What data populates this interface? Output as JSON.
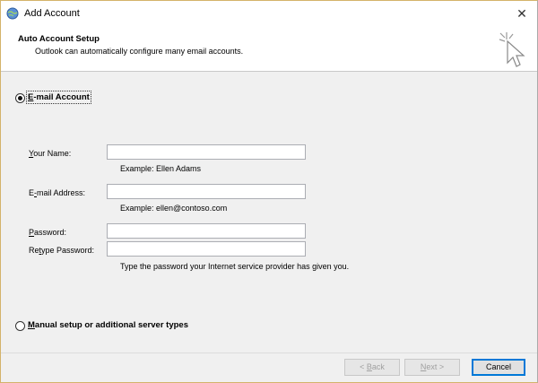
{
  "window": {
    "title": "Add Account",
    "close_glyph": "✕"
  },
  "header": {
    "title": "Auto Account Setup",
    "subtitle": "Outlook can automatically configure many email accounts."
  },
  "options": {
    "email_account": {
      "label_pre": "",
      "label_accel": "E",
      "label_post": "-mail Account",
      "selected": true
    },
    "manual_setup": {
      "label_accel": "M",
      "label_post": "anual setup or additional server types",
      "selected": false
    }
  },
  "form": {
    "name": {
      "label_accel": "Y",
      "label_post": "our Name:",
      "value": "",
      "hint": "Example: Ellen Adams"
    },
    "email": {
      "label_pre": "E",
      "label_accel": "-",
      "label_post": "mail Address:",
      "value": "",
      "hint": "Example: ellen@contoso.com"
    },
    "password": {
      "label_accel": "P",
      "label_post": "assword:",
      "value": ""
    },
    "retype": {
      "label_pre": "Re",
      "label_accel": "t",
      "label_post": "ype Password:",
      "value": "",
      "hint": "Type the password your Internet service provider has given you."
    }
  },
  "buttons": {
    "back_pre": "< ",
    "back_accel": "B",
    "back_post": "ack",
    "next_accel": "N",
    "next_post": "ext >",
    "cancel": "Cancel"
  },
  "colors": {
    "accent": "#0078d7",
    "disabled_text": "#a0a0a0"
  }
}
